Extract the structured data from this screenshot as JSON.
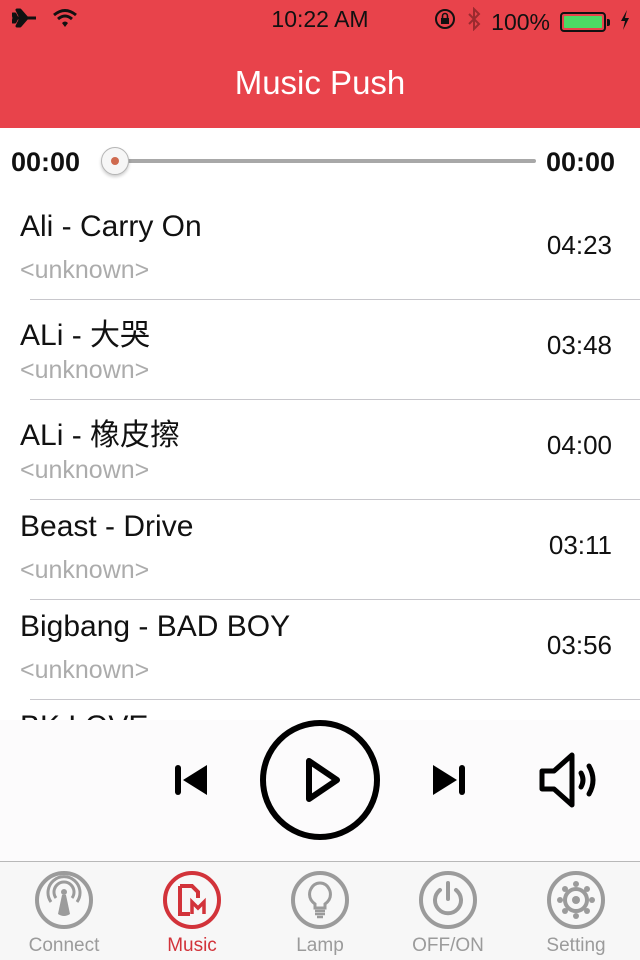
{
  "status_bar": {
    "time": "10:22 AM",
    "battery_percent": "100%",
    "battery_level": 1.0,
    "icons": [
      "airplane-icon",
      "wifi-icon",
      "rotation-lock-icon",
      "bluetooth-icon",
      "battery-icon",
      "charging-icon"
    ]
  },
  "header": {
    "title": "Music Push"
  },
  "colors": {
    "brand": "#e8434b",
    "active_tab": "#d2333a",
    "inactive_tab": "#9b9b9b",
    "battery": "#4cd964"
  },
  "progress": {
    "elapsed": "00:00",
    "total": "00:00",
    "position": 0.0
  },
  "tracks": [
    {
      "title": "Ali - Carry On",
      "artist": "<unknown>",
      "duration": "04:23"
    },
    {
      "title": "ALi - 大哭",
      "artist": "<unknown>",
      "duration": "03:48"
    },
    {
      "title": "ALi - 橡皮擦",
      "artist": "<unknown>",
      "duration": "04:00"
    },
    {
      "title": "Beast - Drive",
      "artist": "<unknown>",
      "duration": "03:11"
    },
    {
      "title": "Bigbang - BAD BOY",
      "artist": "<unknown>",
      "duration": "03:56"
    },
    {
      "title": "BK LOVE",
      "artist": "",
      "duration": ""
    }
  ],
  "player": {
    "controls": [
      "previous-icon",
      "play-icon",
      "next-icon",
      "volume-icon"
    ]
  },
  "tabs": [
    {
      "label": "Connect",
      "icon": "antenna-icon",
      "active": false
    },
    {
      "label": "Music",
      "icon": "music-icon",
      "active": true
    },
    {
      "label": "Lamp",
      "icon": "lightbulb-icon",
      "active": false
    },
    {
      "label": "OFF/ON",
      "icon": "power-icon",
      "active": false
    },
    {
      "label": "Setting",
      "icon": "gear-icon",
      "active": false
    }
  ]
}
